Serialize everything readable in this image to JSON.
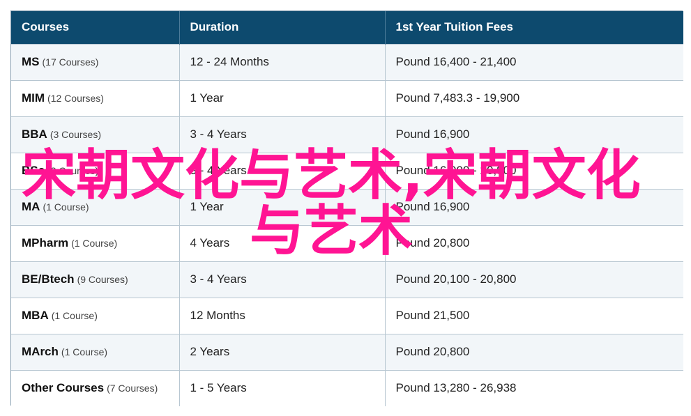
{
  "table": {
    "headers": [
      "Courses",
      "Duration",
      "1st Year Tuition Fees"
    ],
    "rows": [
      {
        "course": "MS",
        "count": "(17 Courses)",
        "duration": "12 - 24 Months",
        "fees": "Pound 16,400 - 21,400"
      },
      {
        "course": "MIM",
        "count": "(12 Courses)",
        "duration": "1 Year",
        "fees": "Pound 7,483.3 - 19,900"
      },
      {
        "course": "BBA",
        "count": "(3 Courses)",
        "duration": "3 - 4 Years",
        "fees": "Pound 16,900"
      },
      {
        "course": "BSc",
        "count": "(3 Courses)",
        "duration": "3 - 4 Years",
        "fees": "Pound 16,900 - 20,800"
      },
      {
        "course": "MA",
        "count": "(1 Course)",
        "duration": "1 Year",
        "fees": "Pound 16,900"
      },
      {
        "course": "MPharm",
        "count": "(1 Course)",
        "duration": "4 Years",
        "fees": "Pound 20,800"
      },
      {
        "course": "BE/Btech",
        "count": "(9 Courses)",
        "duration": "3 - 4 Years",
        "fees": "Pound 20,100 - 20,800"
      },
      {
        "course": "MBA",
        "count": "(1 Course)",
        "duration": "12 Months",
        "fees": "Pound 21,500"
      },
      {
        "course": "MArch",
        "count": "(1 Course)",
        "duration": "2 Years",
        "fees": "Pound 20,800"
      },
      {
        "course": "Other Courses",
        "count": "(7 Courses)",
        "duration": "1 - 5 Years",
        "fees": "Pound 13,280 - 26,938"
      }
    ]
  },
  "watermark": {
    "text": "宋朝文化与艺术,宋朝文化与艺术",
    "color": "#ff1493"
  }
}
